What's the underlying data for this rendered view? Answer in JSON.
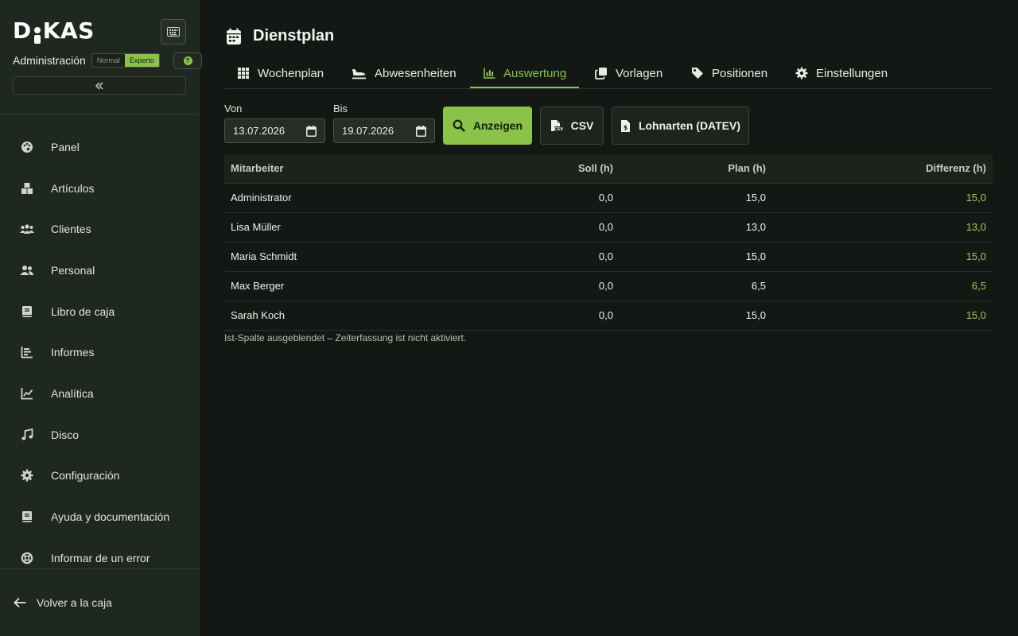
{
  "sidebar": {
    "logo_text_left": "D",
    "logo_text_right": "KAS",
    "role_label": "Administración",
    "mode_options": [
      "Normal",
      "Experto"
    ],
    "mode_active": "Experto",
    "help_glyph": "?",
    "nav_items": [
      {
        "label": "Panel",
        "icon": "palette-icon"
      },
      {
        "label": "Artículos",
        "icon": "boxes-icon"
      },
      {
        "label": "Clientes",
        "icon": "users-icon"
      },
      {
        "label": "Personal",
        "icon": "user-group-icon"
      },
      {
        "label": "Libro de caja",
        "icon": "book-icon"
      },
      {
        "label": "Informes",
        "icon": "bar-chart-icon"
      },
      {
        "label": "Analítica",
        "icon": "line-chart-icon"
      },
      {
        "label": "Disco",
        "icon": "music-icon"
      },
      {
        "label": "Configuración",
        "icon": "gear-icon"
      },
      {
        "label": "Ayuda y documentación",
        "icon": "book-icon"
      },
      {
        "label": "Informar de un error",
        "icon": "lifebuoy-icon"
      }
    ],
    "back_label": "Volver a la caja"
  },
  "header": {
    "title": "Dienstplan"
  },
  "tabs": [
    {
      "label": "Wochenplan",
      "icon": "grid-icon"
    },
    {
      "label": "Abwesenheiten",
      "icon": "plane-icon"
    },
    {
      "label": "Auswertung",
      "icon": "chart-icon",
      "active": true
    },
    {
      "label": "Vorlagen",
      "icon": "copy-icon"
    },
    {
      "label": "Positionen",
      "icon": "tag-icon"
    },
    {
      "label": "Einstellungen",
      "icon": "gear-icon"
    }
  ],
  "filters": {
    "from_label": "Von",
    "from_value": "13.07.2026",
    "to_label": "Bis",
    "to_value": "19.07.2026",
    "show_button": "Anzeigen",
    "csv_button": "CSV",
    "datev_button": "Lohnarten (DATEV)"
  },
  "table": {
    "columns": [
      "Mitarbeiter",
      "Soll (h)",
      "Plan (h)",
      "Differenz (h)"
    ],
    "rows": [
      {
        "name": "Administrator",
        "soll": "0,0",
        "plan": "15,0",
        "diff": "15,0"
      },
      {
        "name": "Lisa Müller",
        "soll": "0,0",
        "plan": "13,0",
        "diff": "13,0"
      },
      {
        "name": "Maria Schmidt",
        "soll": "0,0",
        "plan": "15,0",
        "diff": "15,0"
      },
      {
        "name": "Max Berger",
        "soll": "0,0",
        "plan": "6,5",
        "diff": "6,5"
      },
      {
        "name": "Sarah Koch",
        "soll": "0,0",
        "plan": "15,0",
        "diff": "15,0"
      }
    ],
    "note": "Ist-Spalte ausgeblendet – Zeiterfassung ist nicht aktiviert."
  },
  "colors": {
    "accent": "#8bc34a",
    "sidebar_bg": "#1f2820",
    "main_bg": "#141814",
    "positive_text": "#9ccc65"
  }
}
